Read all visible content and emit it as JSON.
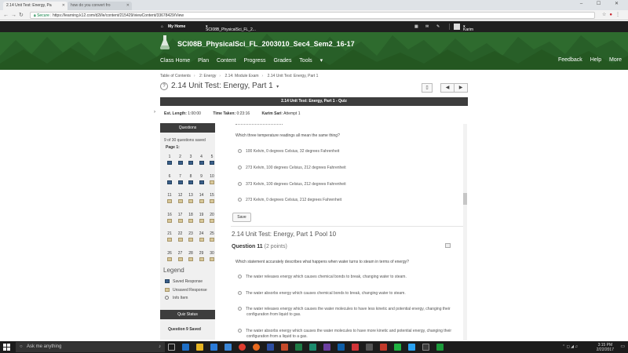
{
  "browser": {
    "tabs": [
      {
        "label": "2.14 Unit Test: Energy, Pa",
        "active": true
      },
      {
        "label": "how do you convert fro",
        "active": false
      }
    ],
    "url_secure": "Secure",
    "url": "https://learning.k12.com/d2l/le/content/215429/viewContent/33678429/View",
    "icons": [
      "back-icon",
      "forward-icon",
      "reload-icon",
      "star-icon",
      "pinterest-icon",
      "menu-icon"
    ]
  },
  "topstrip": {
    "home": "My Home",
    "course": "SCI08B_PhysicalSci_FL_2...",
    "user": "Karim Sari"
  },
  "header": {
    "course_title": "SCI08B_PhysicalSci_FL_2003010_Sec4_Sem2_16-17",
    "nav": [
      "Class Home",
      "Plan",
      "Content",
      "Progress",
      "Grades",
      "Tools"
    ],
    "right_nav": [
      "Feedback",
      "Help",
      "More"
    ],
    "brand_color": "#2e6b2e"
  },
  "breadcrumb": [
    "Table of Contents",
    "2: Energy",
    "2.14: Module Exam",
    "2.14 Unit Test: Energy, Part 1"
  ],
  "page_title": "2.14 Unit Test: Energy, Part 1",
  "quiz": {
    "banner": "2.14 Unit Test: Energy, Part 1 - Quiz",
    "est_length_label": "Est. Length:",
    "est_length": "1:00:00",
    "time_taken_label": "Time Taken:",
    "time_taken": "0:23:16",
    "attempt_user": "Karim Sari",
    "attempt": "Attempt 1"
  },
  "questions_panel": {
    "title": "Questions",
    "saved_text": "9 of 30 questions saved",
    "page_label": "Page 1:",
    "numbers": [
      1,
      2,
      3,
      4,
      5,
      6,
      7,
      8,
      9,
      10,
      11,
      12,
      13,
      14,
      15,
      16,
      17,
      18,
      19,
      20,
      21,
      22,
      23,
      24,
      25,
      26,
      27,
      28,
      29,
      30
    ],
    "saved_count": 9
  },
  "legend": {
    "title": "Legend",
    "saved": "Saved Response",
    "unsaved": "Unsaved Response",
    "info": "Info Item"
  },
  "quiz_status": {
    "title": "Quiz Status",
    "text": "Question 9 Saved"
  },
  "q10": {
    "prompt": "Which three temperature readings all mean the same thing?",
    "choices": [
      "100 Kelvin, 0 degrees Celsius, 32 degrees Fahrenheit",
      "273 Kelvin, 100 degrees Celsius, 212 degrees Fahrenheit",
      "373 Kelvin, 100 degrees Celsius, 212 degrees Fahrenheit",
      "273 Kelvin, 0 degrees Celsius, 212 degrees Fahrenheit"
    ],
    "save_label": "Save"
  },
  "pool_title": "2.14 Unit Test: Energy, Part 1 Pool 10",
  "q11": {
    "title": "Question 11",
    "points": "(2 points)",
    "prompt": "Which statement accurately describes what happens when water turns to steam in terms of energy?",
    "choices": [
      "The water releases energy which causes chemical bonds to break, changing water to steam.",
      "The water absorbs energy which causes chemical bonds to break, changing water to steam.",
      "The water releases energy which causes the water molecules to have less kinetic and potential energy, changing their configuration from liquid to gas.",
      "The water absorbs energy which causes the water molecules to have more kinetic and potential energy, changing their configuration from a liquid to a gas."
    ]
  },
  "taskbar": {
    "search_placeholder": "Ask me anything",
    "time": "3:15 PM",
    "date": "2/22/2017"
  }
}
